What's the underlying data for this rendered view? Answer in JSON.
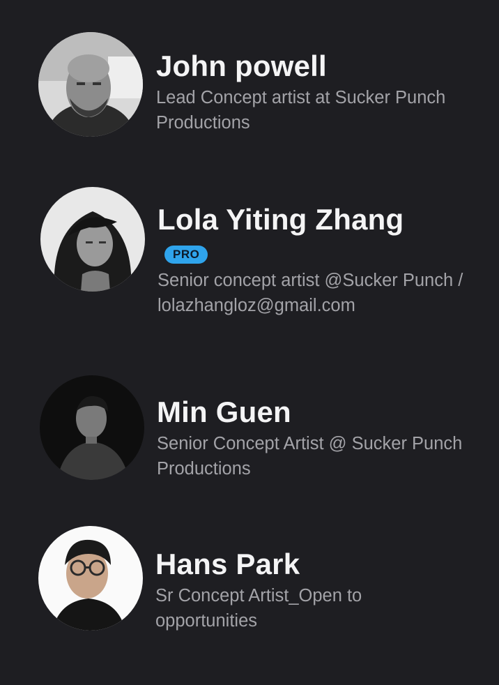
{
  "profiles": [
    {
      "name": "John powell",
      "description": "Lead Concept artist at Sucker Punch Productions",
      "badge": ""
    },
    {
      "name": "Lola Yiting Zhang",
      "description": "Senior concept artist @Sucker Punch / lolazhangloz@gmail.com",
      "badge": "PRO"
    },
    {
      "name": "Min Guen",
      "description": "Senior Concept Artist @ Sucker Punch Productions",
      "badge": ""
    },
    {
      "name": "Hans Park",
      "description": "Sr Concept Artist_Open to opportunities",
      "badge": ""
    }
  ],
  "colors": {
    "background": "#1e1e22",
    "name_text": "#f4f4f5",
    "description_text": "#a3a3a8",
    "pro_badge": "#2fa4ec"
  }
}
